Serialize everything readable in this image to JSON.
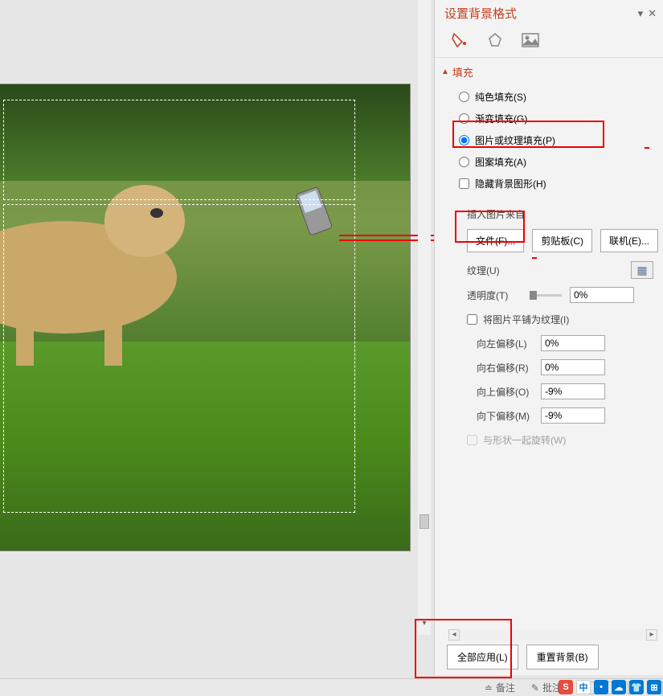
{
  "panel": {
    "title": "设置背景格式",
    "section": "填充",
    "options": {
      "solid": "纯色填充(S)",
      "gradient": "渐变填充(G)",
      "picture": "图片或纹理填充(P)",
      "pattern": "图案填充(A)",
      "hide_bg": "隐藏背景图形(H)"
    },
    "insert_from": "插入图片来自",
    "buttons": {
      "file": "文件(F)...",
      "clipboard": "剪贴板(C)",
      "online": "联机(E)..."
    },
    "texture_label": "纹理(U)",
    "transparency_label": "透明度(T)",
    "transparency_value": "0%",
    "tile_label": "将图片平铺为纹理(I)",
    "offsets": {
      "left_label": "向左偏移(L)",
      "left_value": "0%",
      "right_label": "向右偏移(R)",
      "right_value": "0%",
      "up_label": "向上偏移(O)",
      "up_value": "-9%",
      "down_label": "向下偏移(M)",
      "down_value": "-9%"
    },
    "rotate_label": "与形状一起旋转(W)"
  },
  "footer_buttons": {
    "apply_all": "全部应用(L)",
    "reset": "重置背景(B)"
  },
  "statusbar": {
    "notes": "备注",
    "comments": "批注"
  },
  "tray": {
    "ime": "中"
  }
}
